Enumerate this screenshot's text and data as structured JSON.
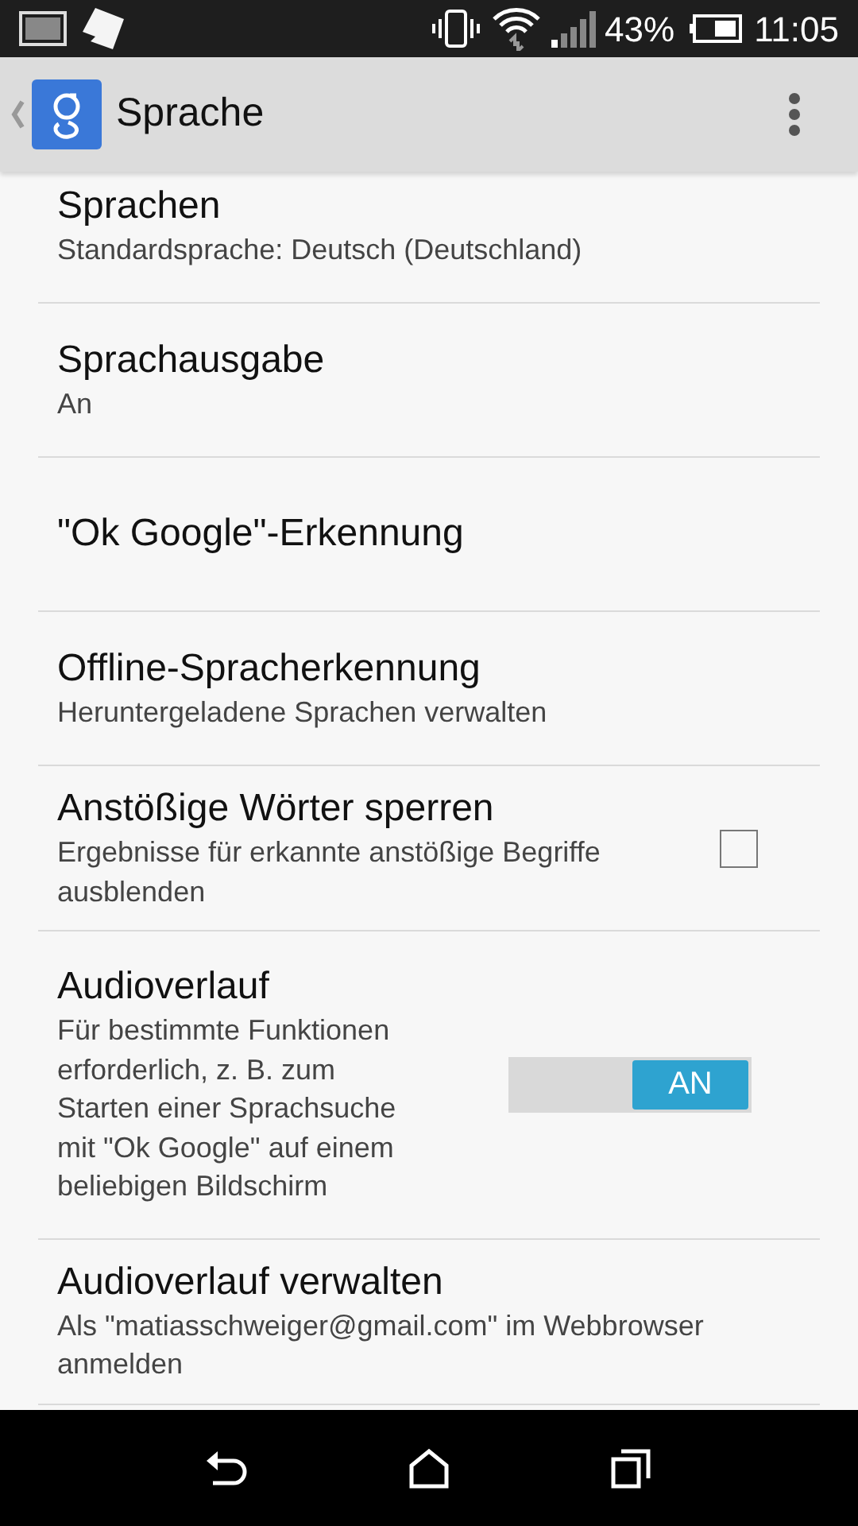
{
  "status_bar": {
    "battery": "43%",
    "time": "11:05"
  },
  "action_bar": {
    "title": "Sprache"
  },
  "settings": [
    {
      "kind": "text",
      "title": "Sprachen",
      "subtitle": "Standardsprache: Deutsch (Deutschland)"
    },
    {
      "kind": "text",
      "title": "Sprachausgabe",
      "subtitle": "An"
    },
    {
      "kind": "text",
      "title": "\"Ok Google\"-Erkennung"
    },
    {
      "kind": "text",
      "title": "Offline-Spracherkennung",
      "subtitle": "Heruntergeladene Sprachen verwalten"
    },
    {
      "kind": "checkbox",
      "title": "Anstößige Wörter sperren",
      "subtitle": "Ergebnisse für erkannte anstößige Begriffe ausblenden",
      "checked": false
    },
    {
      "kind": "toggle",
      "title": "Audioverlauf",
      "subtitle": "Für bestimmte Funktionen erforderlich, z. B. zum Starten einer Sprachsuche mit \"Ok Google\" auf einem beliebigen Bildschirm",
      "on": true,
      "toggle_label": "AN"
    },
    {
      "kind": "text",
      "title": "Audioverlauf verwalten",
      "subtitle": "Als \"matiasschweiger@gmail.com\" im Webbrowser anmelden"
    }
  ]
}
